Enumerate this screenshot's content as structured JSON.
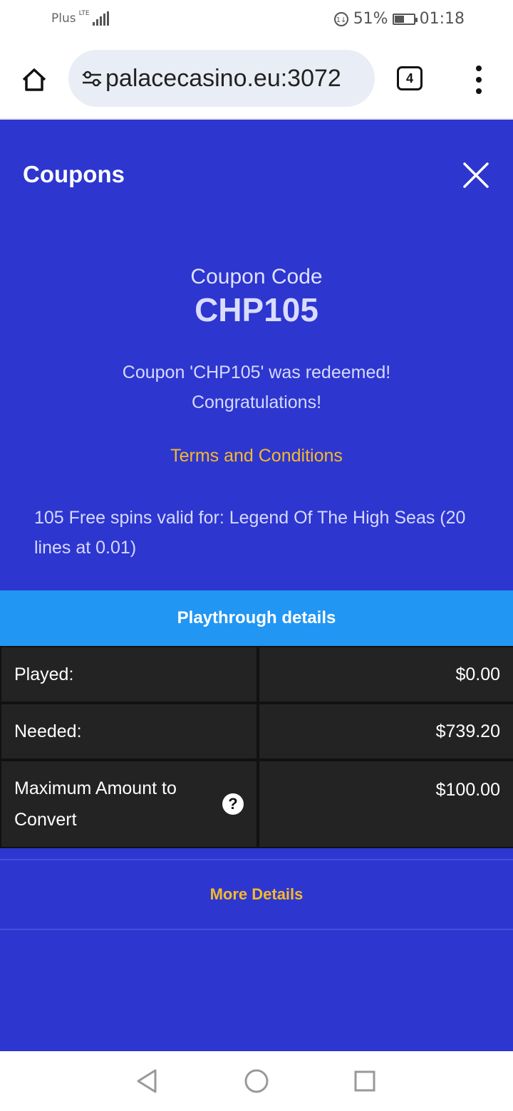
{
  "status_bar": {
    "carrier": "Plus",
    "network": "LTE",
    "battery_percent_text": "51%",
    "battery_level": 0.51,
    "time": "01:18"
  },
  "browser": {
    "url_text": "palacecasino.eu:3072",
    "tab_count": "4",
    "icons": [
      "home-icon",
      "site-settings-icon",
      "tabs-icon",
      "overflow-menu-icon"
    ]
  },
  "modal": {
    "title": "Coupons",
    "close_icon": "close-icon",
    "coupon_label": "Coupon Code",
    "coupon_code": "CHP105",
    "redeemed_line1": "Coupon 'CHP105' was redeemed!",
    "redeemed_line2": "Congratulations!",
    "terms_link": "Terms and Conditions",
    "spins_text": "105 Free spins valid for: Legend Of The High Seas (20 lines at 0.01)",
    "playthrough_header": "Playthrough details",
    "rows": [
      {
        "label": "Played:",
        "value": "$0.00"
      },
      {
        "label": "Needed:",
        "value": "$739.20"
      },
      {
        "label": "Maximum Amount to Convert",
        "value": "$100.00",
        "help": "?"
      }
    ],
    "more_details": "More Details"
  },
  "colors": {
    "modal_bg": "#2d36cf",
    "header_bg": "#2196f3",
    "accent_gold": "#f4b92d",
    "table_cell": "#232323"
  },
  "nav_bar": {
    "icons": [
      "back-icon",
      "home-circle-icon",
      "recents-icon"
    ]
  }
}
